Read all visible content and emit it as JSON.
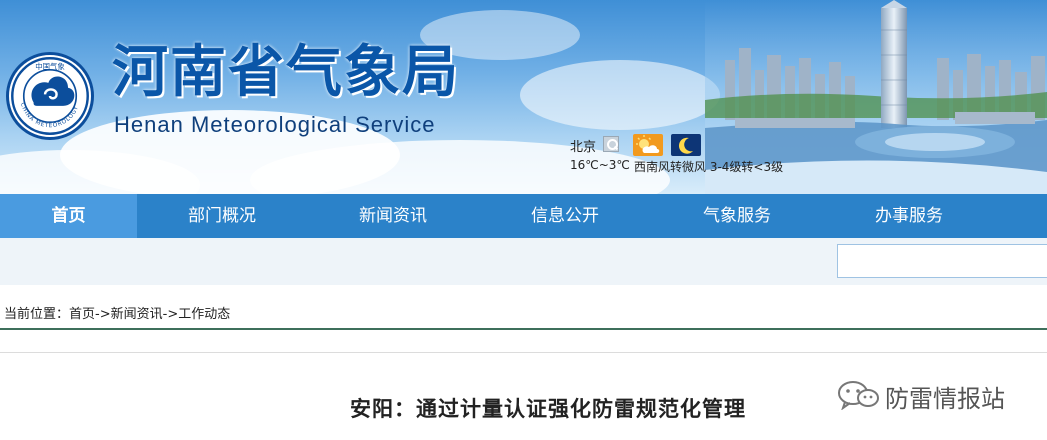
{
  "header": {
    "title_cn": "河南省气象局",
    "title_en": "Henan  Meteorological Service",
    "logo": {
      "top_text": "中国气象",
      "ring_text": "CHINA METEOROLOGY",
      "icon": "cma-logo-icon",
      "color": "#0c4e9c"
    }
  },
  "weather": {
    "city": "北京",
    "temperature": "16℃~3℃",
    "wind": "西南风转微风 3-4级转<3级",
    "day_icon": "sun-cloud-icon",
    "night_icon": "moon-icon"
  },
  "nav": {
    "items": [
      {
        "label": "首页",
        "active": true
      },
      {
        "label": "部门概况",
        "active": false
      },
      {
        "label": "新闻资讯",
        "active": false
      },
      {
        "label": "信息公开",
        "active": false
      },
      {
        "label": "气象服务",
        "active": false
      },
      {
        "label": "办事服务",
        "active": false
      }
    ]
  },
  "search": {
    "placeholder": ""
  },
  "breadcrumb": {
    "prefix": "当前位置：",
    "home": "首页",
    "sep1": "->",
    "section": "新闻资讯",
    "sep2": "->",
    "current": "工作动态"
  },
  "article": {
    "title": "安阳：通过计量认证强化防雷规范化管理"
  },
  "watermark": {
    "text": "防雷情报站",
    "icon": "wechat-icon"
  },
  "colors": {
    "nav_bg": "#2b82c9",
    "nav_active": "#4a9be0",
    "title_blue": "#0a56a8",
    "rule": "#3e6f5b"
  }
}
